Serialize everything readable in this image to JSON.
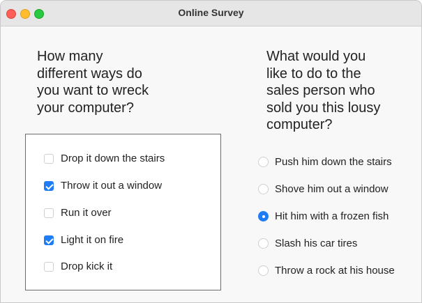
{
  "window": {
    "title": "Online Survey"
  },
  "question1": {
    "text": "How many\ndifferent ways do\nyou want to wreck\nyour computer?",
    "options": [
      {
        "label": "Drop it down the stairs",
        "checked": false
      },
      {
        "label": "Throw it out a window",
        "checked": true
      },
      {
        "label": "Run it over",
        "checked": false
      },
      {
        "label": "Light it on fire",
        "checked": true
      },
      {
        "label": "Drop kick it",
        "checked": false
      }
    ]
  },
  "question2": {
    "text": "What would you\nlike to do to the\nsales person who\nsold you this lousy\ncomputer?",
    "options": [
      {
        "label": "Push him down the stairs",
        "selected": false
      },
      {
        "label": "Shove him out a window",
        "selected": false
      },
      {
        "label": "Hit him with a frozen fish",
        "selected": true
      },
      {
        "label": "Slash his car tires",
        "selected": false
      },
      {
        "label": "Throw a rock at his house",
        "selected": false
      }
    ]
  },
  "colors": {
    "accent": "#1e7cf5",
    "close": "#fe5f57",
    "minimize": "#febc2e",
    "zoom": "#28c840"
  }
}
